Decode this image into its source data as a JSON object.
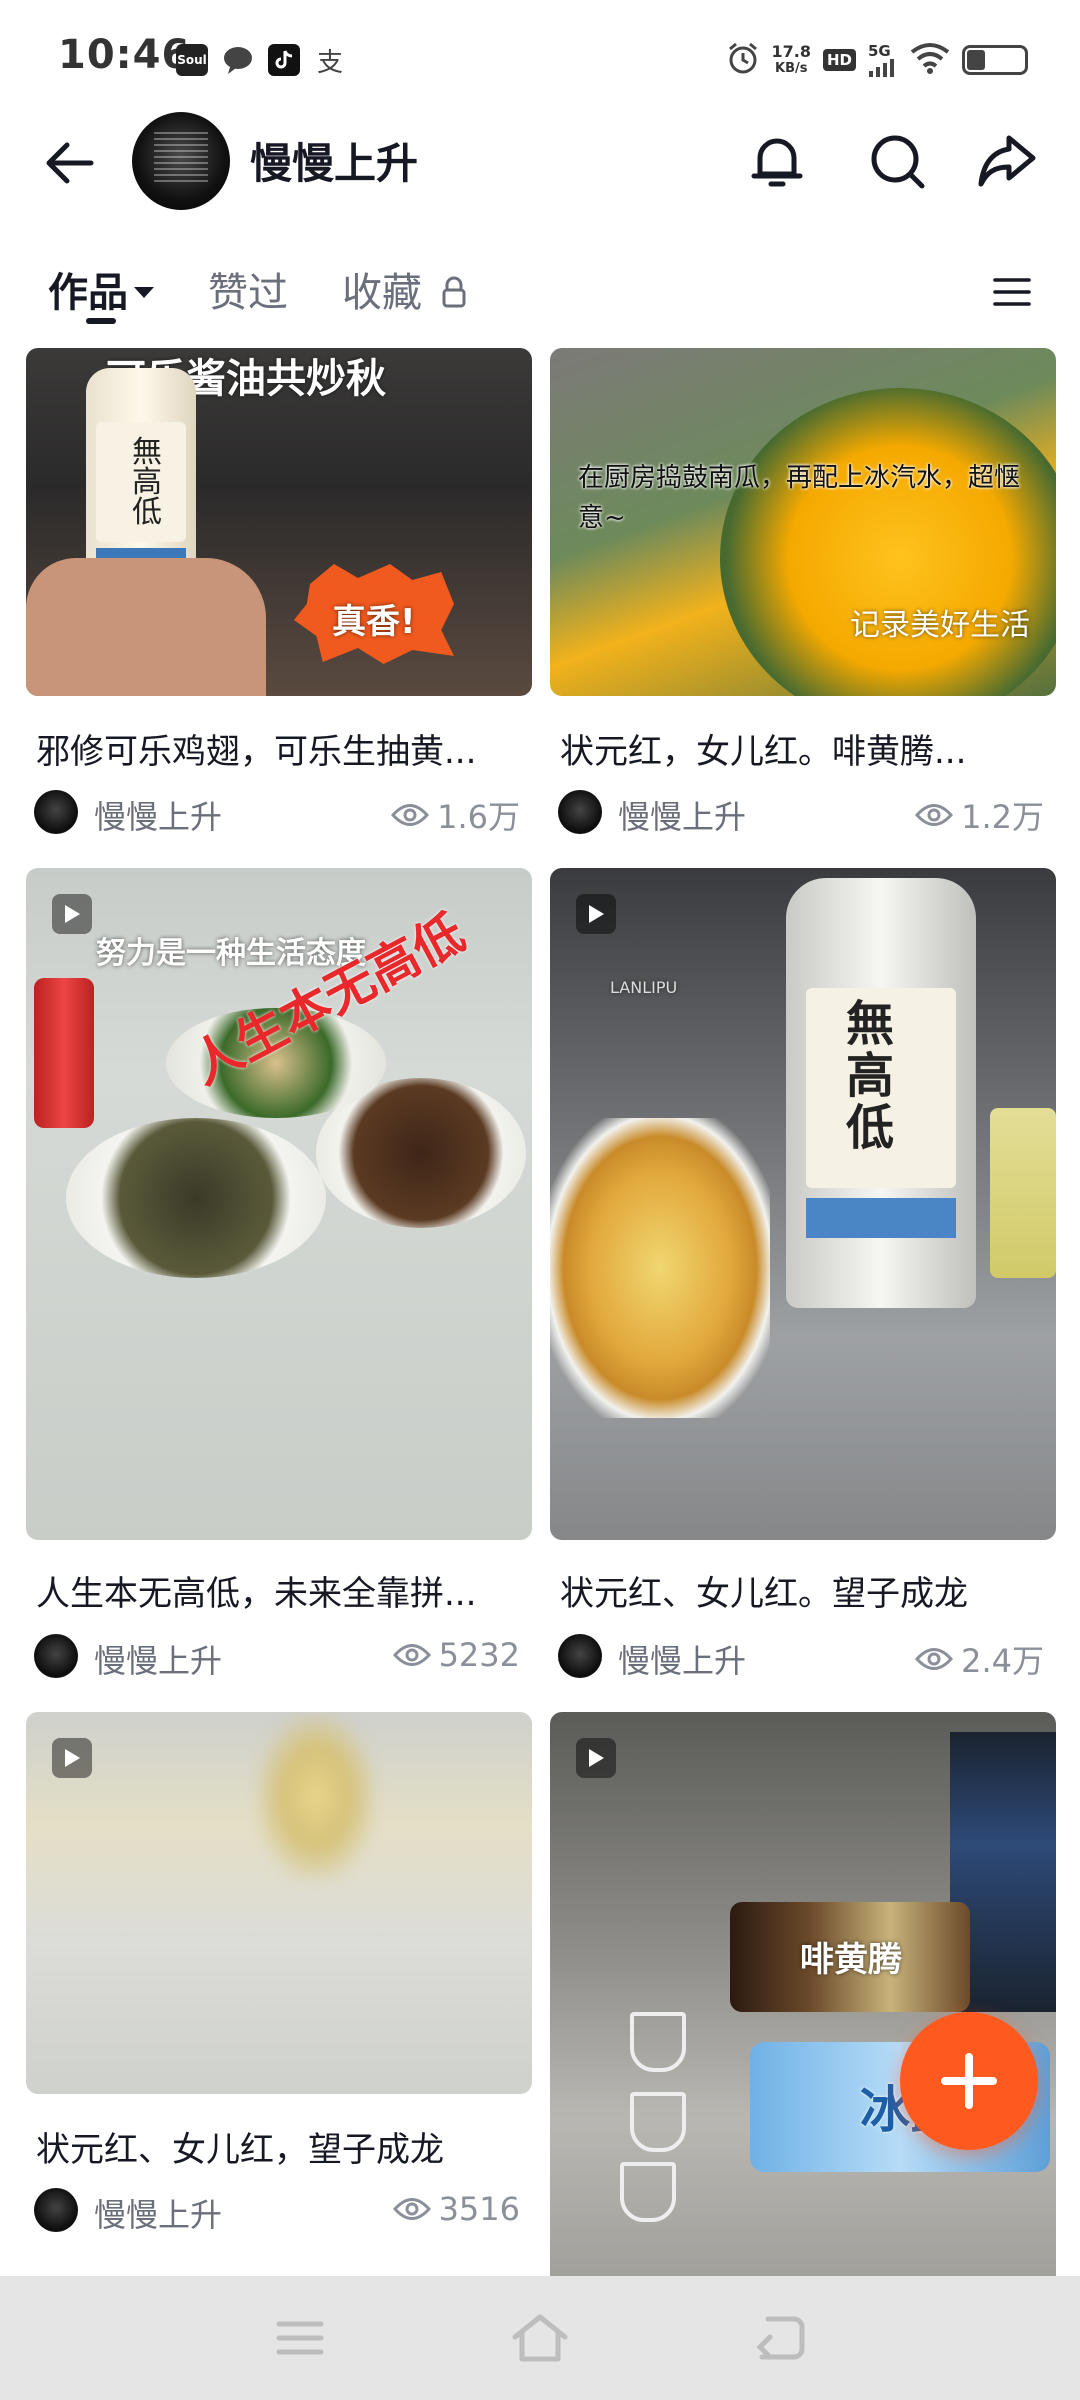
{
  "status_bar": {
    "time": "10:46",
    "apps": [
      "Soul",
      "chat",
      "tiktok",
      "支"
    ],
    "speed_value": "17.8",
    "speed_unit": "KB/s",
    "hd": "HD",
    "network": "5G",
    "battery_level": 0.3
  },
  "header": {
    "back_icon": "arrow-left-icon",
    "name": "慢慢上升",
    "icons": [
      "bell-icon",
      "search-icon",
      "share-icon"
    ]
  },
  "tabs": [
    {
      "label": "作品",
      "active": true
    },
    {
      "label": "赞过",
      "active": false
    },
    {
      "label": "收藏",
      "active": false,
      "locked": true
    }
  ],
  "cards": [
    {
      "title": "邪修可乐鸡翅，可乐生抽黄...",
      "author": "慢慢上升",
      "views": "1.6万",
      "thumb_text": "可乐酱油共炒秋",
      "sticker": "真香!",
      "video": false
    },
    {
      "title": "状元红，女儿红。啡黄腾...",
      "author": "慢慢上升",
      "views": "1.2万",
      "thumb_text": "在厨房捣鼓南瓜，再配上冰汽水，超惬意~",
      "sticker": "记录美好生活",
      "video": false
    },
    {
      "title": "人生本无高低，未来全靠拼...",
      "author": "慢慢上升",
      "views": "5232",
      "thumb_text": "努力是一种生活态度",
      "sticker": "人生本无高低",
      "video": true
    },
    {
      "title": "状元红、女儿红。望子成龙",
      "author": "慢慢上升",
      "views": "2.4万",
      "thumb_text": "無高低",
      "sticker": "LANLIPU",
      "video": true
    },
    {
      "title": "状元红、女儿红，望子成龙",
      "author": "慢慢上升",
      "views": "3516",
      "thumb_text": "",
      "sticker": "",
      "video": true
    },
    {
      "title": "",
      "author": "",
      "views": "",
      "thumb_text": "啡黄腾",
      "sticker": "冰露",
      "video": true
    }
  ],
  "fab": {
    "icon": "plus-icon"
  },
  "navbar": {
    "icons": [
      "menu-icon",
      "home-icon",
      "back-icon"
    ]
  },
  "colors": {
    "accent": "#fe5a1f",
    "text": "#161823",
    "muted": "#6a6f7b"
  }
}
